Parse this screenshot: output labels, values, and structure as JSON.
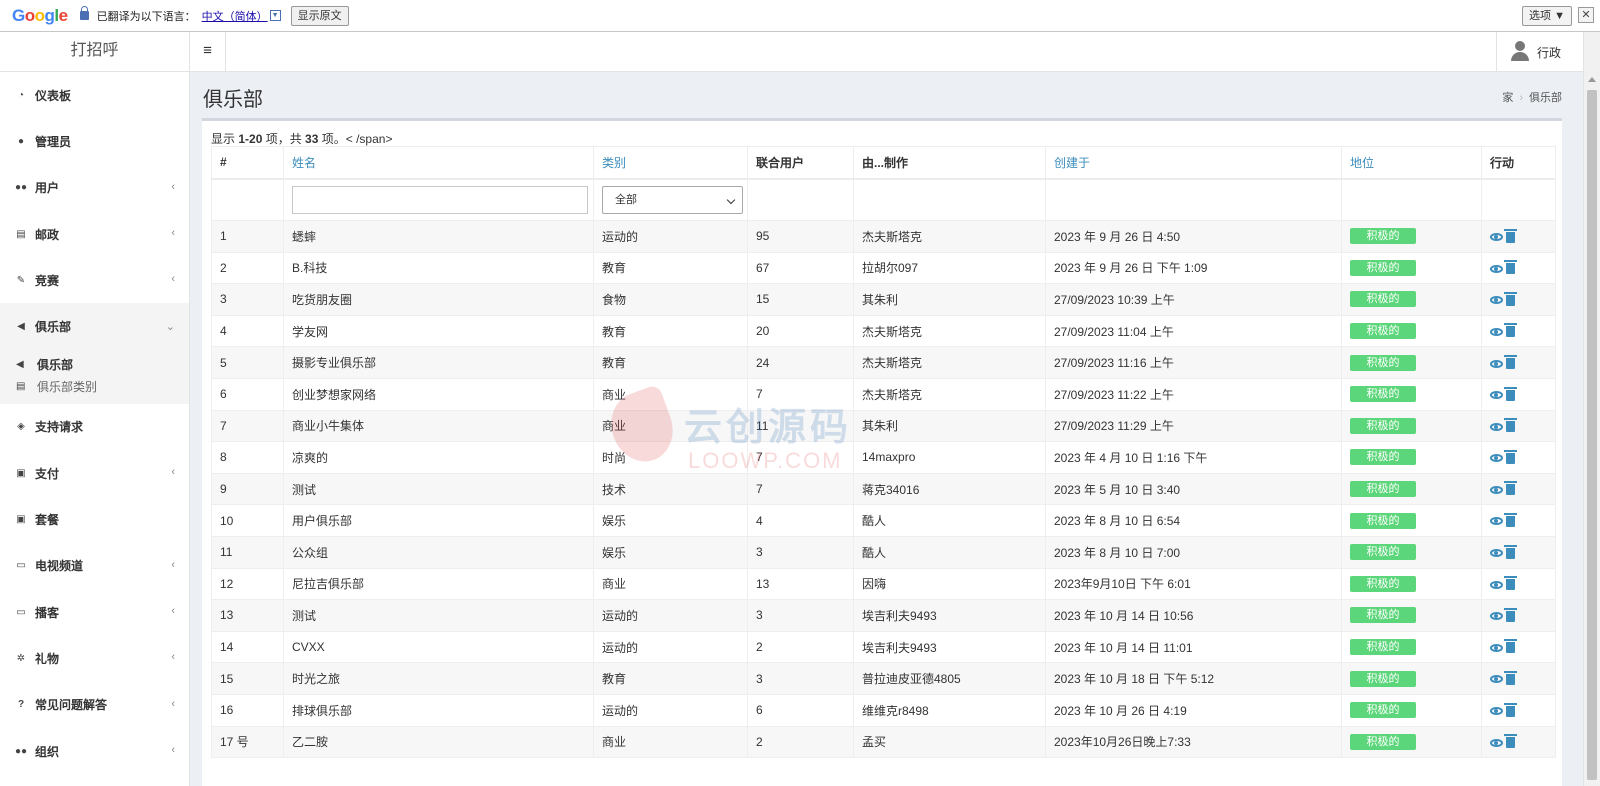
{
  "translate_bar": {
    "logo": "Google",
    "translated_to": "已翻译为以下语言：",
    "language": "中文（简体）",
    "dropdown_glyph": "▼",
    "show_original": "显示原文",
    "options": "选项 ▼",
    "close": "✕"
  },
  "header": {
    "brand": "打招呼",
    "toggle_glyph": "≡",
    "user_name": "行政"
  },
  "sidebar": {
    "items": [
      {
        "icon": "dashboard-icon",
        "glyph": "◔",
        "label": "仪表板",
        "chev": ""
      },
      {
        "icon": "user-icon",
        "glyph": "●",
        "label": "管理员",
        "chev": ""
      },
      {
        "icon": "users-icon",
        "glyph": "●●",
        "label": "用户",
        "chev": "‹"
      },
      {
        "icon": "newspaper-icon",
        "glyph": "▤",
        "label": "邮政",
        "chev": "‹"
      },
      {
        "icon": "compete-icon",
        "glyph": "✎",
        "label": "竞赛",
        "chev": "‹"
      },
      {
        "icon": "megaphone-icon",
        "glyph": "◀",
        "label": "俱乐部",
        "chev": "⌄"
      },
      {
        "icon": "ticket-icon",
        "glyph": "◈",
        "label": "支持请求",
        "chev": ""
      },
      {
        "icon": "money-icon",
        "glyph": "▣",
        "label": "支付",
        "chev": "‹"
      },
      {
        "icon": "package-icon",
        "glyph": "▣",
        "label": "套餐",
        "chev": ""
      },
      {
        "icon": "tv-icon",
        "glyph": "▭",
        "label": "电视频道",
        "chev": "‹"
      },
      {
        "icon": "podcast-icon",
        "glyph": "▭",
        "label": "播客",
        "chev": "‹"
      },
      {
        "icon": "gift-icon",
        "glyph": "✲",
        "label": "礼物",
        "chev": "‹"
      },
      {
        "icon": "question-icon",
        "glyph": "?",
        "label": "常见问题解答",
        "chev": "‹"
      },
      {
        "icon": "org-icon",
        "glyph": "●●",
        "label": "组织",
        "chev": "‹"
      }
    ],
    "sub_items": [
      {
        "icon": "megaphone-icon",
        "glyph": "◀",
        "label": "俱乐部"
      },
      {
        "icon": "list-icon",
        "glyph": "▤",
        "label": "俱乐部类别"
      }
    ]
  },
  "page": {
    "title": "俱乐部",
    "breadcrumb_home": "家",
    "breadcrumb_sep": "›",
    "breadcrumb_current": "俱乐部"
  },
  "summary": {
    "prefix": "显示 ",
    "range": "1-20",
    "mid": " 项，共 ",
    "total": "33",
    "suffix": " 项。< /span>"
  },
  "table": {
    "headers": [
      "#",
      "姓名",
      "类别",
      "联合用户",
      "由...制作",
      "创建于",
      "地位",
      "行动"
    ],
    "filter_select": "全部",
    "rows": [
      [
        "1",
        "蟋蟀",
        "运动的",
        "95",
        "杰夫斯塔克",
        "2023 年 9 月 26 日 4:50",
        "积极的"
      ],
      [
        "2",
        "B.科技",
        "教育",
        "67",
        "拉胡尔097",
        "2023 年 9 月 26 日 下午 1:09",
        "积极的"
      ],
      [
        "3",
        "吃货朋友圈",
        "食物",
        "15",
        "其朱利",
        "27/09/2023 10:39 上午",
        "积极的"
      ],
      [
        "4",
        "学友网",
        "教育",
        "20",
        "杰夫斯塔克",
        "27/09/2023 11:04 上午",
        "积极的"
      ],
      [
        "5",
        "摄影专业俱乐部",
        "教育",
        "24",
        "杰夫斯塔克",
        "27/09/2023 11:16 上午",
        "积极的"
      ],
      [
        "6",
        "创业梦想家网络",
        "商业",
        "7",
        "杰夫斯塔克",
        "27/09/2023 11:22 上午",
        "积极的"
      ],
      [
        "7",
        "商业小牛集体",
        "商业",
        "11",
        "其朱利",
        "27/09/2023 11:29 上午",
        "积极的"
      ],
      [
        "8",
        "凉爽的",
        "时尚",
        "7",
        "14maxpro",
        "2023 年 4 月 10 日 1:16 下午",
        "积极的"
      ],
      [
        "9",
        "测试",
        "技术",
        "7",
        "蒋克34016",
        "2023 年 5 月 10 日 3:40",
        "积极的"
      ],
      [
        "10",
        "用户俱乐部",
        "娱乐",
        "4",
        "酷人",
        "2023 年 8 月 10 日 6:54",
        "积极的"
      ],
      [
        "11",
        "公众组",
        "娱乐",
        "3",
        "酷人",
        "2023 年 8 月 10 日 7:00",
        "积极的"
      ],
      [
        "12",
        "尼拉吉俱乐部",
        "商业",
        "13",
        "因嗨",
        "2023年9月10日 下午 6:01",
        "积极的"
      ],
      [
        "13",
        "测试",
        "运动的",
        "3",
        "埃吉利夫9493",
        "2023 年 10 月 14 日 10:56",
        "积极的"
      ],
      [
        "14",
        "CVXX",
        "运动的",
        "2",
        "埃吉利夫9493",
        "2023 年 10 月 14 日 11:01",
        "积极的"
      ],
      [
        "15",
        "时光之旅",
        "教育",
        "3",
        "普拉迪皮亚德4805",
        "2023 年 10 月 18 日 下午 5:12",
        "积极的"
      ],
      [
        "16",
        "排球俱乐部",
        "运动的",
        "6",
        "维维克r8498",
        "2023 年 10 月 26 日 4:19",
        "积极的"
      ],
      [
        "17 号",
        "乙二胺",
        "商业",
        "2",
        "孟买",
        "2023年10月26日晚上7:33",
        "积极的"
      ]
    ]
  },
  "watermark": {
    "cn": "云创源码",
    "en": "LOOWP.COM"
  },
  "colors": {
    "link": "#3c8dbc",
    "badge": "#5cd67a",
    "background": "#ecf0f5"
  }
}
